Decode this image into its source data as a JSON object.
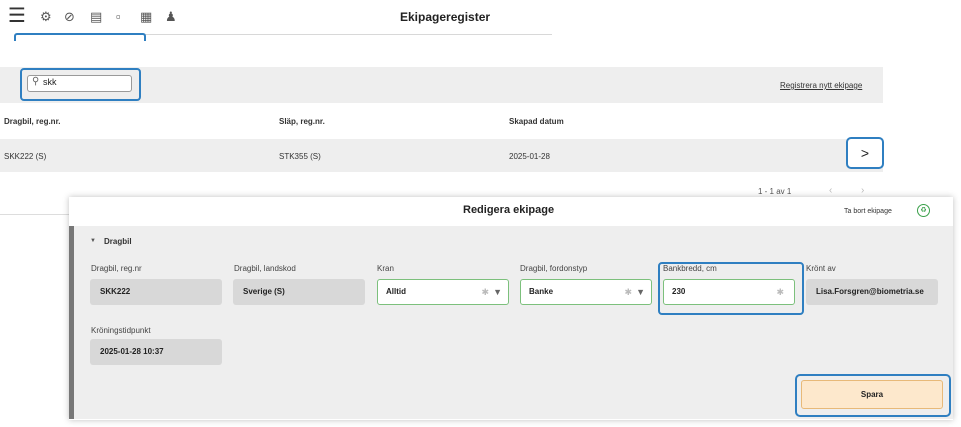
{
  "topbar": {
    "menu_icon": "hamburger-icon",
    "title": "Ekipageregister",
    "icons": [
      "gear-icon",
      "block-icon",
      "truck-icon",
      "trailer-icon",
      "card-icon",
      "user-icon"
    ]
  },
  "search": {
    "value": "skk"
  },
  "list": {
    "register_link": "Registrera nytt ekipage",
    "columns": [
      "Dragbil, reg.nr.",
      "Släp, reg.nr.",
      "Skapad datum"
    ],
    "rows": [
      {
        "dragbil": "SKK222 (S)",
        "slap": "STK355 (S)",
        "datum": "2025-01-28",
        "open": ">"
      }
    ],
    "pagination": "1 - 1 av 1",
    "prev": "‹",
    "next": "›"
  },
  "modal": {
    "title": "Redigera ekipage",
    "delete_label": "Ta bort ekipage",
    "section": {
      "toggle": "▼",
      "title": "Dragbil"
    },
    "fields": {
      "regnr": {
        "label": "Dragbil, reg.nr",
        "value": "SKK222"
      },
      "landskod": {
        "label": "Dragbil, landskod",
        "value": "Sverige (S)"
      },
      "kran": {
        "label": "Kran",
        "value": "Alltid"
      },
      "fordonstyp": {
        "label": "Dragbil, fordonstyp",
        "value": "Banke"
      },
      "bankbredd": {
        "label": "Bankbredd, cm",
        "value": "230"
      },
      "kront_av": {
        "label": "Krönt av",
        "value": "Lisa.Forsgren@biometria.se"
      },
      "kroningstid": {
        "label": "Kröningstidpunkt",
        "value": "2025-01-28 10:37"
      }
    },
    "save_label": "Spara"
  },
  "colors": {
    "highlight": "#2f7fc1",
    "valid_border": "#7cc07c",
    "save_bg": "#fde8cc"
  }
}
